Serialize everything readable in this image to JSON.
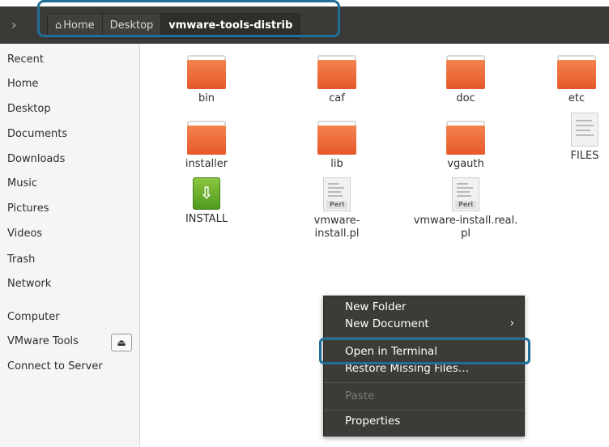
{
  "toolbar": {
    "breadcrumbs": [
      {
        "label": "Home"
      },
      {
        "label": "Desktop"
      },
      {
        "label": "vmware-tools-distrib"
      }
    ]
  },
  "sidebar": {
    "items": [
      {
        "label": "Recent"
      },
      {
        "label": "Home"
      },
      {
        "label": "Desktop"
      },
      {
        "label": "Documents"
      },
      {
        "label": "Downloads"
      },
      {
        "label": "Music"
      },
      {
        "label": "Pictures"
      },
      {
        "label": "Videos"
      },
      {
        "label": "Trash"
      },
      {
        "label": "Network"
      },
      {
        "label": "Computer"
      },
      {
        "label": "VMware Tools"
      },
      {
        "label": "Connect to Server"
      }
    ]
  },
  "files": [
    {
      "name": "bin",
      "type": "folder"
    },
    {
      "name": "caf",
      "type": "folder"
    },
    {
      "name": "doc",
      "type": "folder"
    },
    {
      "name": "etc",
      "type": "folder"
    },
    {
      "name": "installer",
      "type": "folder"
    },
    {
      "name": "lib",
      "type": "folder"
    },
    {
      "name": "vgauth",
      "type": "folder"
    },
    {
      "name": "FILES",
      "type": "text"
    },
    {
      "name": "INSTALL",
      "type": "installer"
    },
    {
      "name": "vmware-install.pl",
      "type": "perl",
      "tag": "Perl"
    },
    {
      "name": "vmware-install.real.pl",
      "line1": "vmware-install.real.",
      "line2": "pl",
      "type": "perl",
      "tag": "Perl"
    }
  ],
  "context_menu": {
    "items": [
      {
        "label": "New Folder"
      },
      {
        "label": "New Document"
      },
      {
        "label": "Open in Terminal"
      },
      {
        "label": "Restore Missing Files…"
      },
      {
        "label": "Paste"
      },
      {
        "label": "Properties"
      }
    ]
  }
}
